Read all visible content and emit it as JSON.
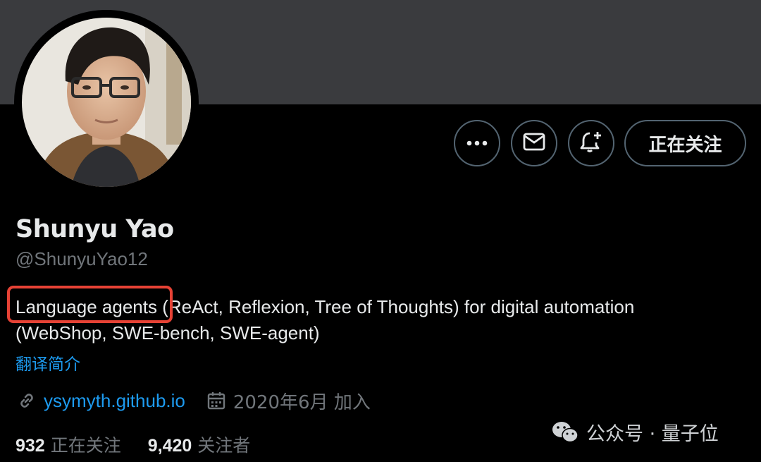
{
  "profile": {
    "name": "Shunyu Yao",
    "handle": "@ShunyuYao12",
    "bio_highlight": "Language agents",
    "bio_rest": " (ReAct, Reflexion, Tree of Thoughts) for digital automation (WebShop, SWE-bench, SWE-agent)",
    "translate_label": "翻译简介",
    "website": "ysymyth.github.io",
    "joined": "2020年6月 加入"
  },
  "actions": {
    "more_icon": "more-icon",
    "message_icon": "mail-icon",
    "notify_icon": "bell-plus-icon",
    "follow_label": "正在关注"
  },
  "stats": {
    "following_count": "932",
    "following_label": "正在关注",
    "followers_count": "9,420",
    "followers_label": "关注者"
  },
  "watermark": {
    "text": "公众号 · 量子位"
  },
  "colors": {
    "background": "#000000",
    "banner": "#3a3b3e",
    "link": "#1d9bf0",
    "secondary_text": "#71767b",
    "highlight_box": "#e64235"
  }
}
